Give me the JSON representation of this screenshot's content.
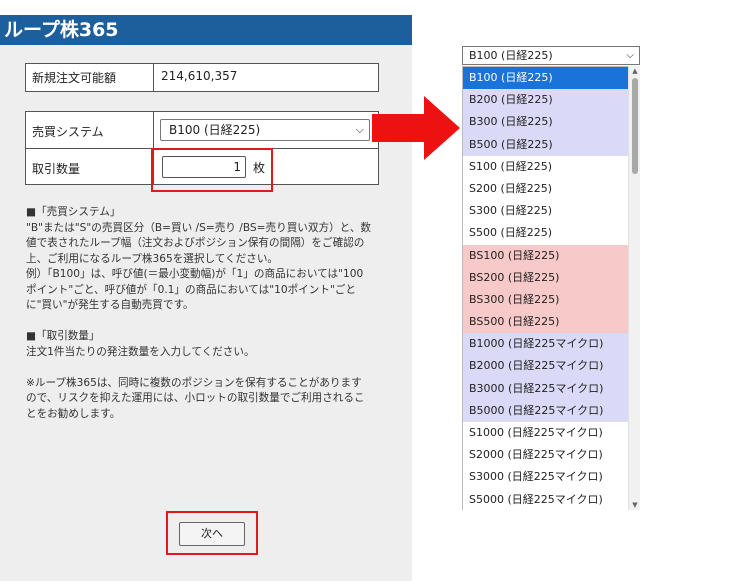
{
  "panel": {
    "title": "ループ株365",
    "amount_label": "新規注文可能額",
    "amount_value": "214,610,357",
    "trade_label": "売買システム",
    "trade_selected": "B100 (日経225)",
    "qty_label": "取引数量",
    "qty_value": "1",
    "qty_unit": "枚",
    "desc": [
      "■「売買システム」",
      "\"B\"または\"S\"の売買区分（B=買い /S=売り /BS=売り買い双方）と、数値で表されたループ幅（注文およびポジション保有の間隔）をご確認の上、ご利用になるループ株365を選択してください。",
      "例）「B100」は、呼び値(＝最小変動幅)が「1」の商品においては\"100ポイント\"ごと、呼び値が「0.1」の商品においては\"10ポイント\"ごとに\"買い\"が発生する自動売買です。",
      "",
      "■「取引数量」",
      "注文1件当たりの発注数量を入力してください。",
      "",
      "※ループ株365は、同時に複数のポジションを保有することがありますので、リスクを抑えた運用には、小ロットの取引数量でご利用されることをお勧めします。"
    ],
    "next_label": "次へ"
  },
  "dropdown": {
    "selected_label": "B100 (日経225)",
    "options": [
      {
        "label": "B100 (日経225)",
        "group": "selected"
      },
      {
        "label": "B200 (日経225)",
        "group": "blue"
      },
      {
        "label": "B300 (日経225)",
        "group": "blue"
      },
      {
        "label": "B500 (日経225)",
        "group": "blue"
      },
      {
        "label": "S100 (日経225)",
        "group": "white"
      },
      {
        "label": "S200 (日経225)",
        "group": "white"
      },
      {
        "label": "S300 (日経225)",
        "group": "white"
      },
      {
        "label": "S500 (日経225)",
        "group": "white"
      },
      {
        "label": "BS100 (日経225)",
        "group": "pink"
      },
      {
        "label": "BS200 (日経225)",
        "group": "pink"
      },
      {
        "label": "BS300 (日経225)",
        "group": "pink"
      },
      {
        "label": "BS500 (日経225)",
        "group": "pink"
      },
      {
        "label": "B1000 (日経225マイクロ)",
        "group": "blue"
      },
      {
        "label": "B2000 (日経225マイクロ)",
        "group": "blue"
      },
      {
        "label": "B3000 (日経225マイクロ)",
        "group": "blue"
      },
      {
        "label": "B5000 (日経225マイクロ)",
        "group": "blue"
      },
      {
        "label": "S1000 (日経225マイクロ)",
        "group": "white"
      },
      {
        "label": "S2000 (日経225マイクロ)",
        "group": "white"
      },
      {
        "label": "S3000 (日経225マイクロ)",
        "group": "white"
      },
      {
        "label": "S5000 (日経225マイクロ)",
        "group": "white"
      }
    ]
  },
  "colors": {
    "title_bar": "#1d5f9c",
    "highlight_red": "#e01a1a",
    "buy_group": "#dadaf8",
    "buy_sell_group": "#f8c9c9",
    "selected_option": "#1a73d9"
  },
  "icons": {
    "select_chevron": "chevron-down-icon",
    "arrow": "right-arrow-icon"
  }
}
